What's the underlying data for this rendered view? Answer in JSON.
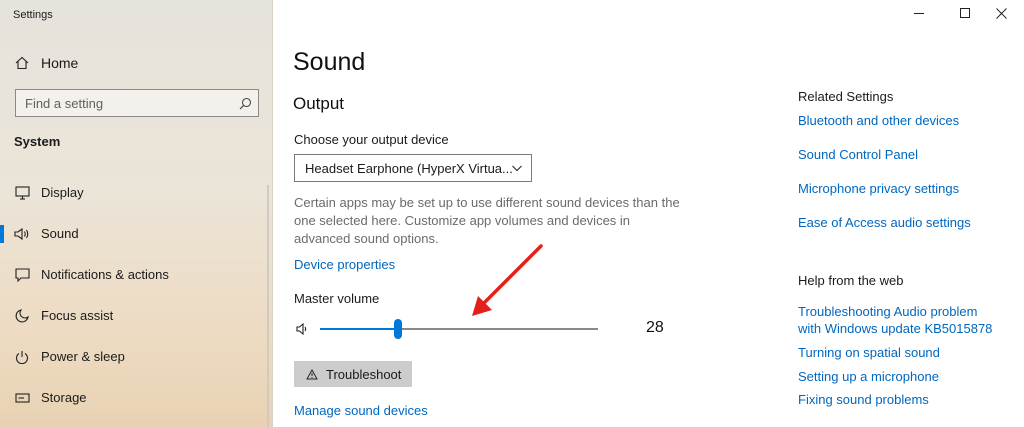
{
  "window": {
    "title": "Settings",
    "controls": [
      "minimize",
      "maximize",
      "close"
    ]
  },
  "sidebar": {
    "home_label": "Home",
    "search_placeholder": "Find a setting",
    "section_label": "System",
    "items": [
      {
        "label": "Display",
        "icon": "display-icon"
      },
      {
        "label": "Sound",
        "icon": "speaker-icon",
        "selected": true
      },
      {
        "label": "Notifications & actions",
        "icon": "notifications-icon"
      },
      {
        "label": "Focus assist",
        "icon": "moon-icon"
      },
      {
        "label": "Power & sleep",
        "icon": "power-icon"
      },
      {
        "label": "Storage",
        "icon": "storage-icon"
      }
    ]
  },
  "main": {
    "title": "Sound",
    "output_heading": "Output",
    "device_label": "Choose your output device",
    "device_value": "Headset Earphone (HyperX Virtua...",
    "description": "Certain apps may be set up to use different sound devices than the one selected here. Customize app volumes and devices in advanced sound options.",
    "device_properties_link": "Device properties",
    "master_volume_label": "Master volume",
    "volume_value": "28",
    "troubleshoot_label": "Troubleshoot",
    "manage_devices_link": "Manage sound devices"
  },
  "related": {
    "heading": "Related Settings",
    "links": [
      "Bluetooth and other devices",
      "Sound Control Panel",
      "Microphone privacy settings",
      "Ease of Access audio settings"
    ]
  },
  "help": {
    "heading": "Help from the web",
    "links": [
      "Troubleshooting Audio problem",
      "with Windows update KB5015878",
      "Turning on spatial sound",
      "Setting up a microphone",
      "Fixing sound problems"
    ]
  },
  "colors": {
    "accent": "#0078d7",
    "link": "#0067c0",
    "annotation_arrow": "#e3201b"
  },
  "annotation": {
    "icon": "red-arrow-annotation"
  }
}
